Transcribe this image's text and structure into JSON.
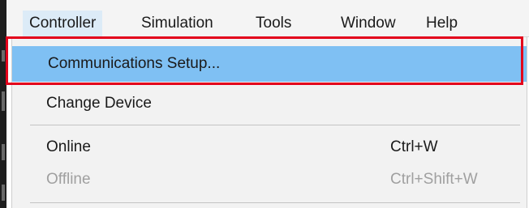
{
  "menubar": {
    "items": [
      {
        "label": "Controller",
        "active": true
      },
      {
        "label": "Simulation",
        "active": false
      },
      {
        "label": "Tools",
        "active": false
      },
      {
        "label": "Window",
        "active": false
      },
      {
        "label": "Help",
        "active": false
      }
    ]
  },
  "controller_menu": {
    "items": [
      {
        "label": "Communications Setup...",
        "shortcut": "",
        "highlighted": true,
        "enabled": true
      },
      {
        "label": "Change Device",
        "shortcut": "",
        "highlighted": false,
        "enabled": true
      },
      {
        "label": "Online",
        "shortcut": "Ctrl+W",
        "highlighted": false,
        "enabled": true
      },
      {
        "label": "Offline",
        "shortcut": "Ctrl+Shift+W",
        "highlighted": false,
        "enabled": false
      }
    ]
  },
  "colors": {
    "hover_highlight": "#7fc0f3",
    "annotation_box": "#e3001b",
    "disabled_text": "#a0a0a0",
    "menu_background": "#f2f2f2",
    "active_menubar_item": "#dcebf7"
  }
}
